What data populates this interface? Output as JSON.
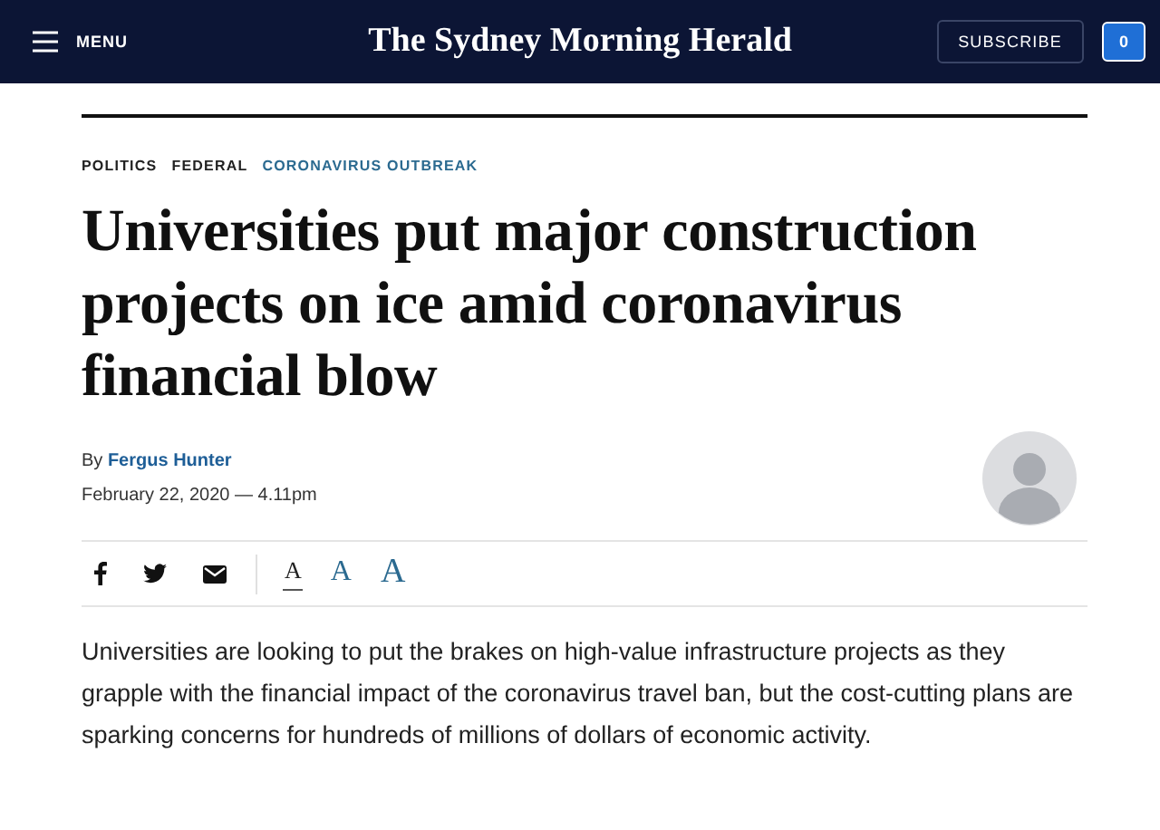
{
  "header": {
    "menu_label": "MENU",
    "logo": "The Sydney Morning Herald",
    "subscribe": "SUBSCRIBE",
    "notification_count": "0"
  },
  "breadcrumbs": [
    {
      "label": "POLITICS",
      "kind": "section"
    },
    {
      "label": "FEDERAL",
      "kind": "section"
    },
    {
      "label": "CORONAVIRUS OUTBREAK",
      "kind": "topic"
    }
  ],
  "headline": "Universities put major construction projects on ice amid coronavirus financial blow",
  "byline": {
    "prefix": "By",
    "author": "Fergus Hunter",
    "date": "February 22, 2020 — 4.11pm"
  },
  "font_sizes": [
    {
      "label": "A",
      "selected": true
    },
    {
      "label": "A",
      "selected": false
    },
    {
      "label": "A",
      "selected": false
    }
  ],
  "body": "Universities are looking to put the brakes on high-value infrastructure projects as they grapple with the financial impact of the coronavirus travel ban, but the cost-cutting plans are sparking concerns for hundreds of millions of dollars of economic activity."
}
